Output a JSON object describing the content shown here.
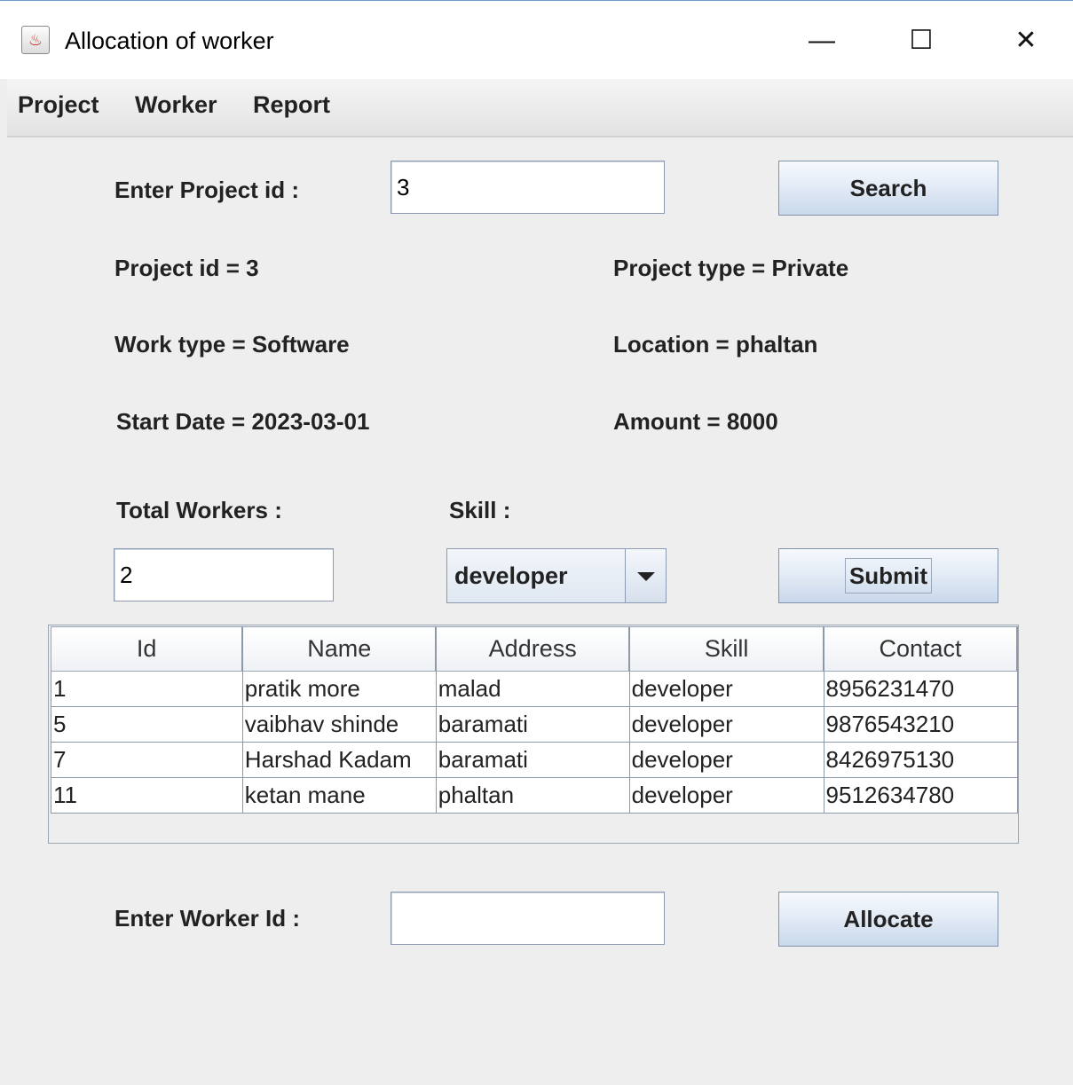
{
  "window": {
    "title": "Allocation of worker",
    "minimize_glyph": "—",
    "maximize_glyph": "☐",
    "close_glyph": "✕"
  },
  "menu": [
    "Project",
    "Worker",
    "Report"
  ],
  "search": {
    "label": "Enter Project id :",
    "value": "3",
    "button": "Search"
  },
  "project": {
    "id_text": "Project id = 3",
    "type_text": "Project type = Private",
    "work_type_text": "Work type = Software",
    "location_text": "Location = phaltan",
    "start_date_text": "Start Date = 2023-03-01",
    "amount_text": "Amount = 8000"
  },
  "filter": {
    "total_workers_label": "Total Workers :",
    "total_workers_value": "2",
    "skill_label": "Skill :",
    "skill_selected": "developer",
    "submit": "Submit"
  },
  "table": {
    "columns": [
      "Id",
      "Name",
      "Address",
      "Skill",
      "Contact"
    ],
    "rows": [
      [
        "1",
        "pratik more",
        "malad",
        "developer",
        "8956231470"
      ],
      [
        "5",
        "vaibhav shinde",
        "baramati",
        "developer",
        "9876543210"
      ],
      [
        "7",
        "Harshad Kadam",
        "baramati",
        "developer",
        "8426975130"
      ],
      [
        "11",
        "ketan mane",
        "phaltan",
        "developer",
        "9512634780"
      ]
    ]
  },
  "allocate": {
    "label": "Enter Worker Id :",
    "value": "",
    "button": "Allocate"
  }
}
